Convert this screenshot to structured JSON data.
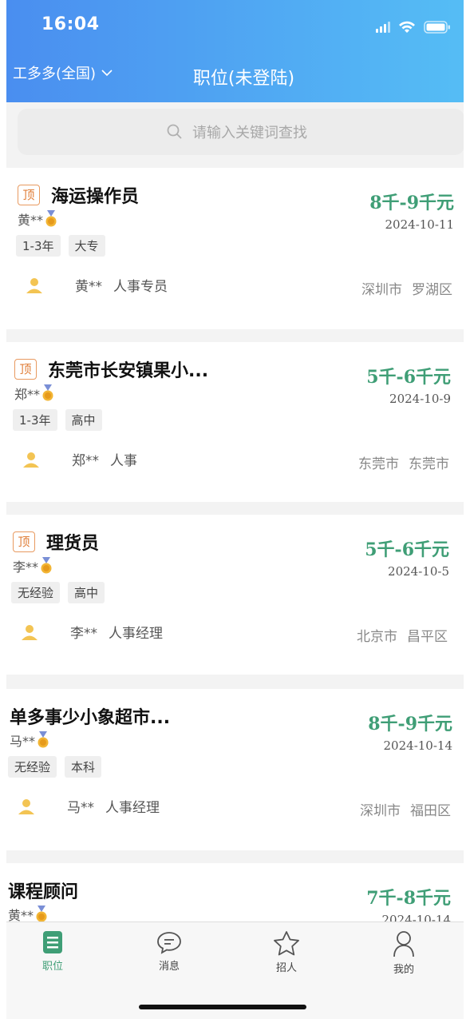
{
  "status": {
    "time": "16:04"
  },
  "header": {
    "region": "工多多(全国)",
    "title": "职位(未登陆)"
  },
  "search": {
    "placeholder": "请输入关键词查找"
  },
  "colors": {
    "accent": "#3f9e76",
    "header_start": "#4a8ef0",
    "header_end": "#55bdf5",
    "top_badge": "#e07f3a"
  },
  "jobs": [
    {
      "top": true,
      "top_label": "顶",
      "title": "海运操作员",
      "poster": "黄**",
      "salary": "8千-9千元",
      "date": "2024-10-11",
      "tags": [
        "1-3年",
        "大专"
      ],
      "contact_name": "黄**",
      "contact_role": "人事专员",
      "city": "深圳市",
      "district": "罗湖区"
    },
    {
      "top": true,
      "top_label": "顶",
      "title": "东莞市长安镇果小...",
      "poster": "郑**",
      "salary": "5千-6千元",
      "date": "2024-10-9",
      "tags": [
        "1-3年",
        "高中"
      ],
      "contact_name": "郑**",
      "contact_role": "人事",
      "city": "东莞市",
      "district": "东莞市"
    },
    {
      "top": true,
      "top_label": "顶",
      "title": "理货员",
      "poster": "李**",
      "salary": "5千-6千元",
      "date": "2024-10-5",
      "tags": [
        "无经验",
        "高中"
      ],
      "contact_name": "李**",
      "contact_role": "人事经理",
      "city": "北京市",
      "district": "昌平区"
    },
    {
      "top": false,
      "title": "单多事少小象超市...",
      "poster": "马**",
      "salary": "8千-9千元",
      "date": "2024-10-14",
      "tags": [
        "无经验",
        "本科"
      ],
      "contact_name": "马**",
      "contact_role": "人事经理",
      "city": "深圳市",
      "district": "福田区"
    },
    {
      "top": false,
      "title": "课程顾问",
      "poster": "黄**",
      "salary": "7千-8千元",
      "date": "2024-10-14"
    }
  ],
  "tabbar": {
    "items": [
      {
        "label": "职位",
        "icon": "job-list-icon",
        "active": true
      },
      {
        "label": "消息",
        "icon": "message-icon",
        "active": false
      },
      {
        "label": "招人",
        "icon": "star-icon",
        "active": false
      },
      {
        "label": "我的",
        "icon": "user-icon",
        "active": false
      }
    ]
  }
}
